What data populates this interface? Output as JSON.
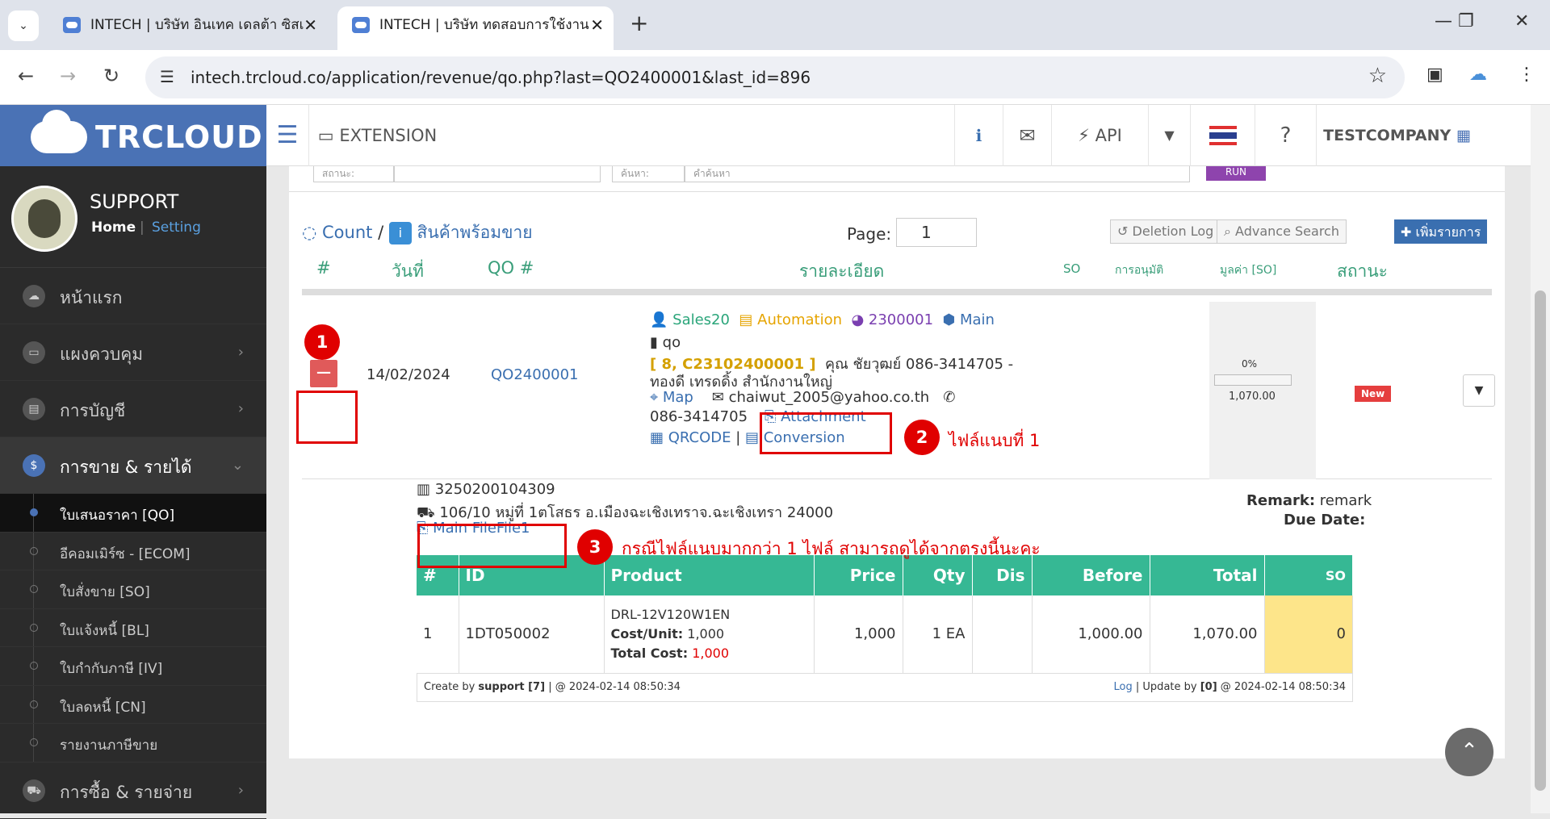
{
  "browser": {
    "tab1_title": "INTECH | บริษัท อินเทค เดลต้า ซิสเ",
    "tab2_title": "INTECH | บริษัท ทดสอบการใช้งาน",
    "url": "intech.trcloud.co/application/revenue/qo.php?last=QO2400001&last_id=896"
  },
  "brand": "TRCLOUD",
  "profile": {
    "name": "SUPPORT",
    "home": "Home",
    "separator": "|",
    "setting": "Setting"
  },
  "menu": [
    {
      "label": "หน้าแรก"
    },
    {
      "label": "แผงควบคุม"
    },
    {
      "label": "การบัญชี"
    },
    {
      "label": "การขาย & รายได้",
      "active": true
    },
    {
      "label": "การซื้อ & รายจ่าย"
    }
  ],
  "submenu": [
    {
      "label": "ใบเสนอราคา [QO]"
    },
    {
      "label": "อีคอมเมิร์ซ - [ECOM]"
    },
    {
      "label": "ใบสั่งขาย [SO]"
    },
    {
      "label": "ใบแจ้งหนี้ [BL]"
    },
    {
      "label": "ใบกำกับภาษี [IV]"
    },
    {
      "label": "ใบลดหนี้ [CN]"
    },
    {
      "label": "รายงานภาษีขาย"
    }
  ],
  "topbar": {
    "extension": "EXTENSION",
    "api": "API",
    "company": "TESTCOMPANY"
  },
  "filters": {
    "status_label": "สถานะ:",
    "search_label": "ค้นหา:",
    "search_placeholder": "คำค้นหา",
    "run": "RUN"
  },
  "toolbar": {
    "count": "Count",
    "slash": "/",
    "ready": "สินค้าพร้อมขาย",
    "page_label": "Page:",
    "page": "1",
    "deletion_log": "Deletion Log",
    "advance_search": "Advance Search",
    "add": "เพิ่มรายการ"
  },
  "columns": {
    "no": "#",
    "date": "วันที่",
    "qo": "QO #",
    "detail": "รายละเอียด",
    "so": "SO",
    "approve": "การอนุมัติ",
    "value": "มูลค่า [SO]",
    "status": "สถานะ"
  },
  "row": {
    "date": "14/02/2024",
    "qo": "QO2400001",
    "sales": "Sales20",
    "automation": "Automation",
    "code": "2300001",
    "main": "Main",
    "doc": "qo",
    "customer_code": "[ 8, C23102400001 ]",
    "customer": "คุณ ชัยวุฒย์ 086-3414705 -",
    "customer2": "ทองดี เทรดดิ้ง สำนักงานใหญ่",
    "map": "Map",
    "email": "chaiwut_2005@yahoo.co.th",
    "phone": "086-3414705",
    "attachment": "Attachment",
    "qrcode": "QRCODE",
    "conversion": "Conversion",
    "progress": "0%",
    "progress_value": 0,
    "amount": "1,070.00",
    "status": "New"
  },
  "detail": {
    "tax_id": "3250200104309",
    "address": "106/10 หมู่ที่ 1ตโสธร อ.เมืองฉะเชิงเทราจ.ฉะเชิงเทรา 24000",
    "file": "Main FileFile1",
    "remark_label": "Remark:",
    "remark": "remark",
    "due_label": "Due Date:",
    "headers": [
      "#",
      "ID",
      "Product",
      "Price",
      "Qty",
      "Dis",
      "Before",
      "Total",
      "SO"
    ],
    "item": {
      "no": "1",
      "id": "1DT050002",
      "product": "DRL-12V120W1EN",
      "cost_label": "Cost/Unit:",
      "cost": "1,000",
      "total_cost_label": "Total Cost:",
      "total_cost": "1,000",
      "price": "1,000",
      "qty": "1 EA",
      "dis": "",
      "before": "1,000.00",
      "total": "1,070.00",
      "so": "0"
    },
    "footer_left_prefix": "Create by",
    "footer_user": "support [7]",
    "footer_left_time": "| @ 2024-02-14 08:50:34",
    "footer_log": "Log",
    "footer_right_prefix": "| Update by",
    "footer_right_user": "[0]",
    "footer_right_time": "@ 2024-02-14 08:50:34"
  },
  "annotations": {
    "n1": "1",
    "n2": "2",
    "n3": "3",
    "text2": "ไฟล์แนบที่ 1",
    "text3": "กรณีไฟล์แนบมากกว่า 1 ไฟล์ สามารถดูได้จากตรงนี้นะคะ"
  }
}
